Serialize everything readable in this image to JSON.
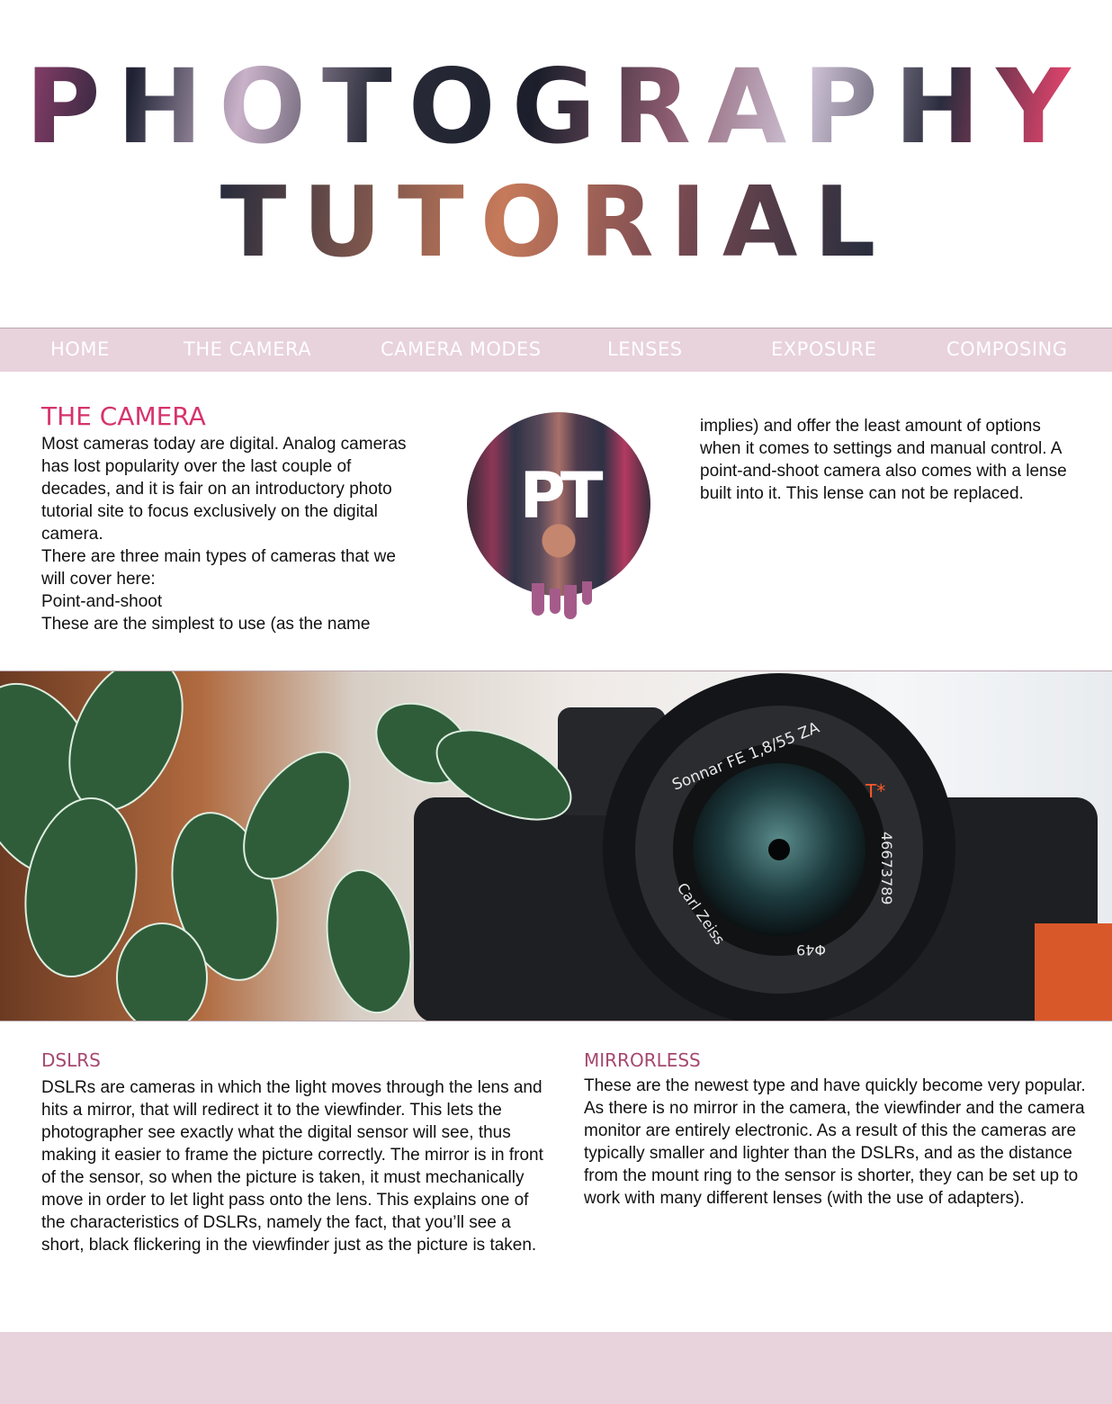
{
  "header": {
    "title_line1": "PHOTOGRAPHY",
    "title_line2": "TUTORIAL"
  },
  "nav": {
    "items": [
      {
        "label": "HOME"
      },
      {
        "label": "THE CAMERA"
      },
      {
        "label": "CAMERA MODES"
      },
      {
        "label": "LENSES"
      },
      {
        "label": "EXPOSURE"
      },
      {
        "label": "COMPOSING"
      }
    ]
  },
  "main": {
    "title": "THE CAMERA",
    "col1": [
      "Most cameras today are digital. Analog cameras has lost popularity over the last couple of decades, and it is fair on an introductory photo tutorial site to focus exclusively on the digital camera.",
      "There are three main types of cameras that we will cover here:",
      "Point-and-shoot",
      "These are the simplest to use (as the name"
    ],
    "col2": "implies) and offer the least amount of options when it comes to settings and manual control. A point-and-shoot camera also comes with a lense built into it. This lense can not be replaced.",
    "logo_text": "PT"
  },
  "banner": {
    "lens_text_top": "Sonnar FE 1,8/55 ZA",
    "lens_mark": "T*",
    "lens_serial": "46673789",
    "lens_brand": "Carl Zeiss",
    "lens_filter": "Φ49"
  },
  "sections": {
    "dslrs": {
      "title": "DSLRS",
      "body": "DSLRs are cameras in which the light moves through the lens and hits a mirror, that will redirect it to the viewfinder. This lets the photographer see exactly what the digital sensor will see, thus making it easier to frame the picture correctly. The mirror is in front of the sensor, so when the picture is taken, it must mechanically move in order to let light pass onto the lens. This explains one of the characteristics of DSLRs, namely the fact, that you’ll see a short, black flickering in the viewfinder just as the picture is taken."
    },
    "mirrorless": {
      "title": "MIRRORLESS",
      "body": "These are the newest type and have quickly become very popular. As there is no mirror in the camera, the viewfinder and the camera monitor are entirely electronic. As a result of this the cameras are typically smaller and lighter than the DSLRs, and as the distance from the mount ring to the sensor is shorter, they can be set up to work with many different lenses (with the use of adapters)."
    }
  },
  "colors": {
    "accent": "#d6336c",
    "sub_accent": "#a5486f",
    "nav_bg": "#e8d2dc"
  }
}
